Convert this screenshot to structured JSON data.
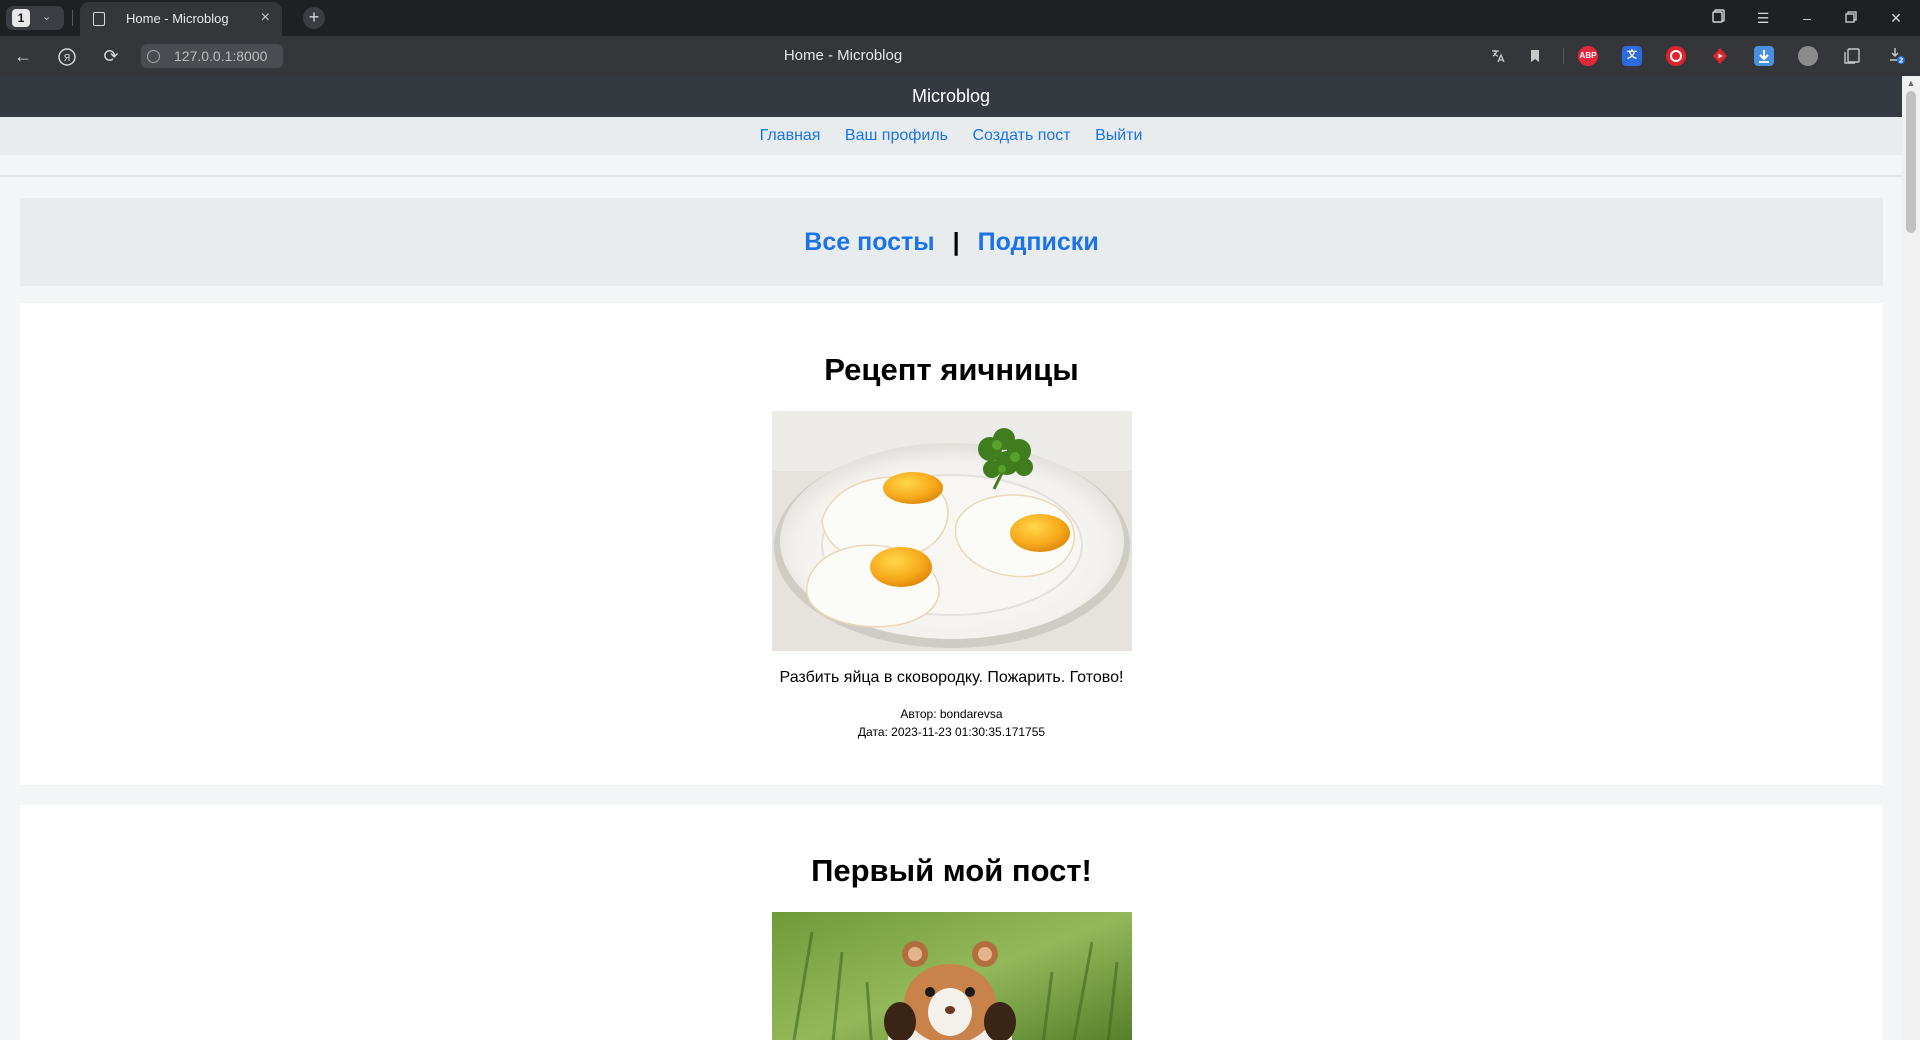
{
  "browser": {
    "tab_count": "1",
    "tab_title": "Home - Microblog",
    "address": "127.0.0.1:8000",
    "window_title": "Home - Microblog",
    "extensions": [
      {
        "name": "translate-icon",
        "label": ""
      },
      {
        "name": "bookmark-icon",
        "label": ""
      },
      {
        "name": "adblock-plus-icon",
        "label": "ABP",
        "color": "#e3263a"
      },
      {
        "name": "translator-extension-icon",
        "label": "",
        "color": "#2c6ce0"
      },
      {
        "name": "red-circle-extension-icon",
        "label": "",
        "color": "#e0242b"
      },
      {
        "name": "youtube-extension-icon",
        "label": "",
        "color": "#e0242b"
      },
      {
        "name": "download-helper-icon",
        "label": "",
        "color": "#4a8fe0"
      },
      {
        "name": "grey-extension-icon",
        "label": "",
        "color": "#8a8a8a"
      },
      {
        "name": "collections-icon",
        "label": ""
      },
      {
        "name": "downloads-icon",
        "label": "2",
        "color": "#1e6fe8"
      }
    ]
  },
  "site": {
    "brand": "Microblog",
    "nav": [
      "Главная",
      "Ваш профиль",
      "Создать пост",
      "Выйти"
    ]
  },
  "feed_switch": {
    "all_posts": "Все посты",
    "separator": "|",
    "subscriptions": "Подписки"
  },
  "posts": [
    {
      "title": "Рецепт яичницы",
      "image": "fried-eggs-photo",
      "text": "Разбить яйца в сковородку. Пожарить. Готово!",
      "author": "Автор: bondarevsa",
      "date": "Дата: 2023-11-23 01:30:35.171755"
    },
    {
      "title": "Первый мой пост!",
      "image": "hamster-photo"
    }
  ],
  "colors": {
    "link": "#1a73e8",
    "header_bg": "#343a40",
    "nav_bg": "#e9ecef",
    "page_bg": "#f4f5f7"
  }
}
